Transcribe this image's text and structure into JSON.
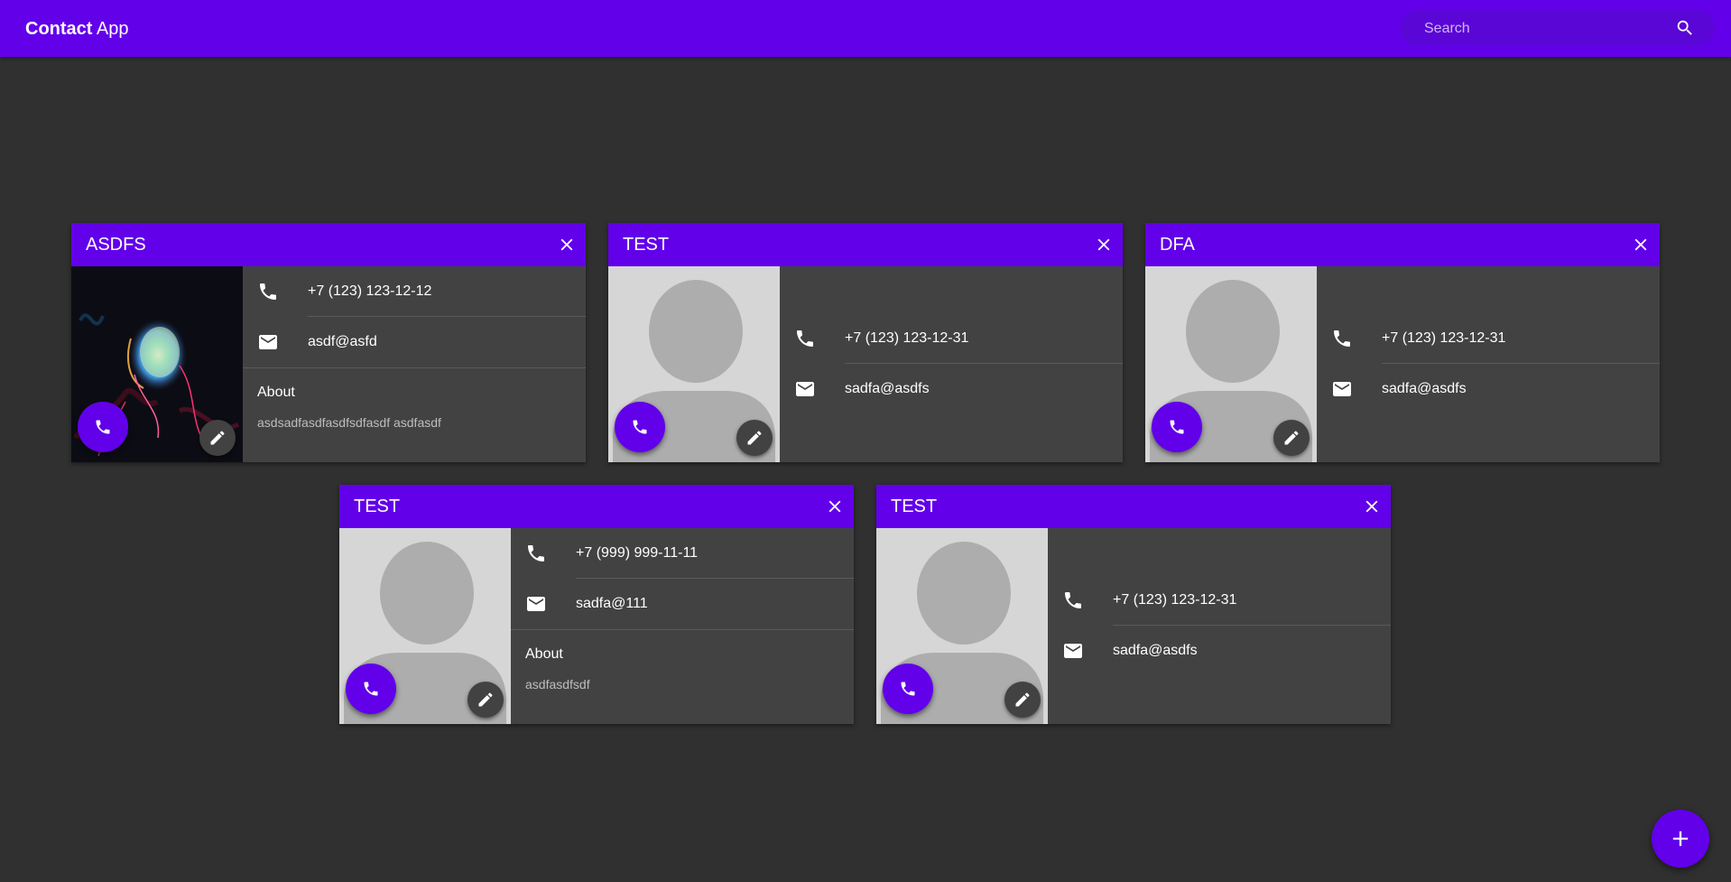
{
  "app": {
    "title_bold": "Contact",
    "title_light": "App",
    "search_placeholder": "Search"
  },
  "contacts": [
    {
      "name": "ASDFS",
      "phone": "+7 (123) 123-12-12",
      "email": "asdf@asfd",
      "about_label": "About",
      "about": "asdsadfasdfasdfsdfasdf asdfasdf",
      "photo": "custom-image"
    },
    {
      "name": "TEST",
      "phone": "+7 (123) 123-12-31",
      "email": "sadfa@asdfs",
      "photo": "placeholder-avatar"
    },
    {
      "name": "DFA",
      "phone": "+7 (123) 123-12-31",
      "email": "sadfa@asdfs",
      "photo": "placeholder-avatar"
    },
    {
      "name": "TEST",
      "phone": "+7 (999) 999-11-11",
      "email": "sadfa@111",
      "about_label": "About",
      "about": "asdfasdfsdf",
      "photo": "placeholder-avatar"
    },
    {
      "name": "TEST",
      "phone": "+7 (123) 123-12-31",
      "email": "sadfa@asdfs",
      "photo": "placeholder-avatar"
    }
  ],
  "icons": {
    "search": "search-icon",
    "close": "close-icon",
    "phone": "phone-icon",
    "email": "email-icon",
    "edit": "edit-icon",
    "add": "add-icon"
  },
  "colors": {
    "primary": "#6200ea",
    "background": "#303030",
    "card": "#424242",
    "avatar_bg": "#d6d6d6",
    "avatar_fg": "#adadad"
  }
}
